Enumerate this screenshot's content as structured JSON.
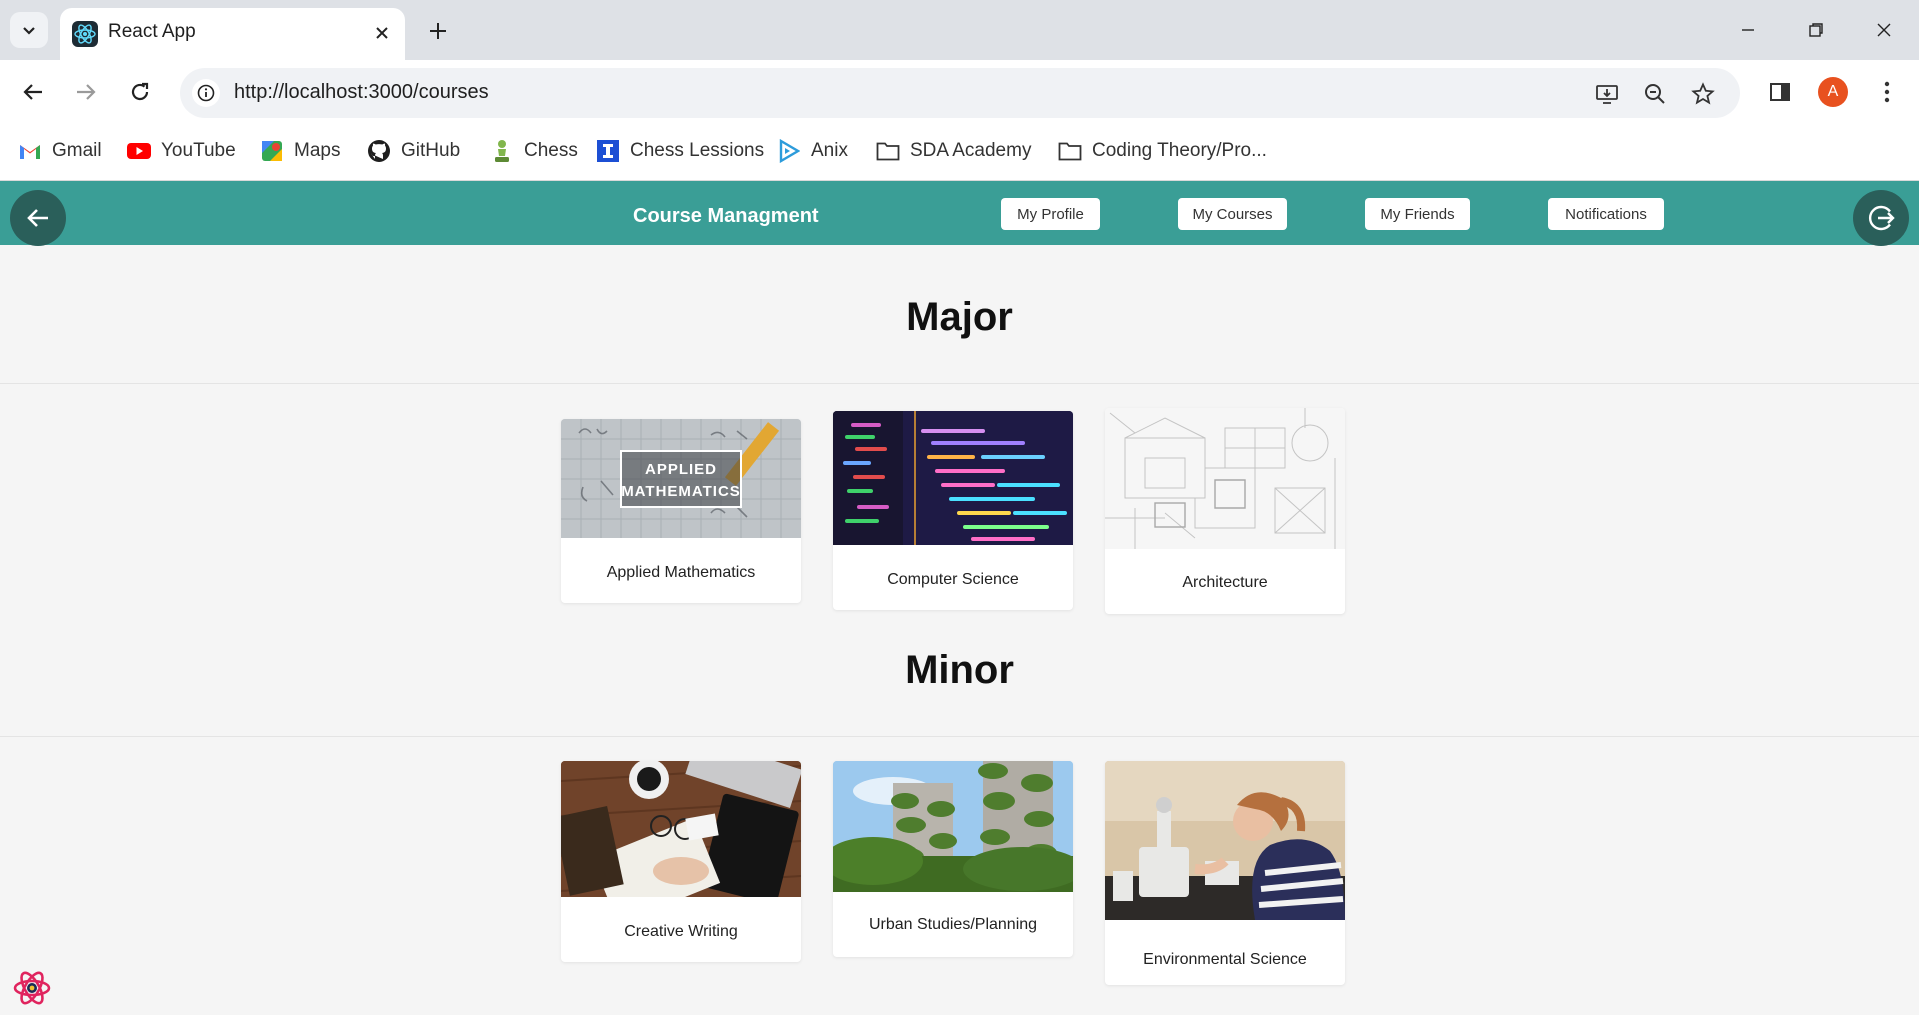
{
  "browser": {
    "tab_title": "React App",
    "url": "http://localhost:3000/courses",
    "profile_initial": "A",
    "bookmarks": [
      {
        "label": "Gmail",
        "icon": "gmail-icon"
      },
      {
        "label": "YouTube",
        "icon": "youtube-icon"
      },
      {
        "label": "Maps",
        "icon": "maps-icon"
      },
      {
        "label": "GitHub",
        "icon": "github-icon"
      },
      {
        "label": "Chess",
        "icon": "chess-pawn-icon"
      },
      {
        "label": "Chess Lessions",
        "icon": "chess-lessons-icon"
      },
      {
        "label": "Anix",
        "icon": "play-icon"
      },
      {
        "label": "SDA Academy",
        "icon": "folder-icon"
      },
      {
        "label": "Coding Theory/Pro...",
        "icon": "folder-icon"
      }
    ]
  },
  "app": {
    "title": "Course Managment",
    "nav": [
      "My Profile",
      "My Courses",
      "My Friends",
      "Notifications"
    ],
    "accent": "#3a9e96",
    "dark_accent": "#2a5f5a"
  },
  "major": {
    "heading": "Major",
    "courses": [
      {
        "name": "Applied Mathematics",
        "image_text": [
          "APPLIED",
          "MATHEMATICS"
        ]
      },
      {
        "name": "Computer Science"
      },
      {
        "name": "Architecture"
      }
    ]
  },
  "minor": {
    "heading": "Minor",
    "courses": [
      {
        "name": "Creative Writing"
      },
      {
        "name": "Urban Studies/Planning"
      },
      {
        "name": "Environmental Science"
      }
    ]
  }
}
